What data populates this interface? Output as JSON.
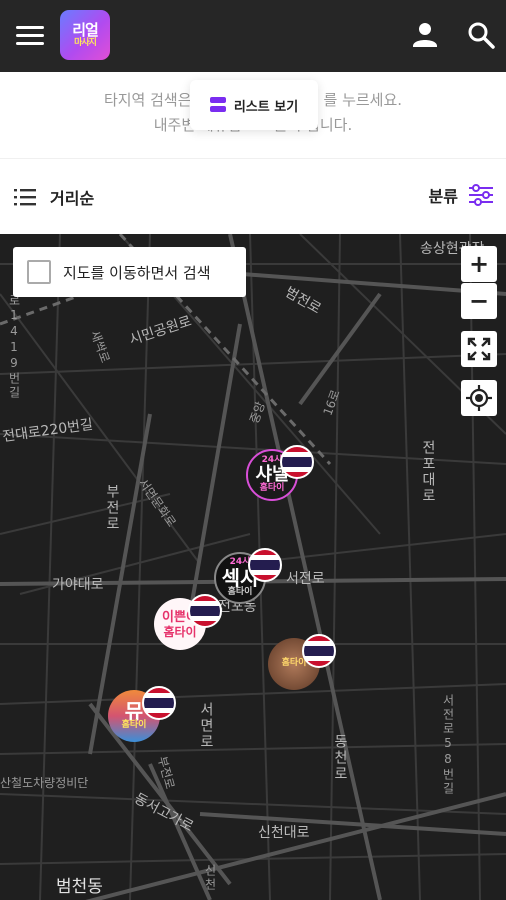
{
  "header": {
    "logo_line1": "리얼",
    "logo_line2": "마사지"
  },
  "notice": {
    "line1_start": "타지역 검색은",
    "line1_end": "를 누르세요.",
    "line2": "내주변 제휴업소 노출이 됩니다.",
    "list_view_label": "리스트 보기"
  },
  "sortbar": {
    "sort_label": "거리순",
    "filter_label": "분류"
  },
  "map": {
    "search_on_move_label": "지도를 이동하면서 검색",
    "zoom_in": "+",
    "zoom_out": "−",
    "labels": {
      "songsang": "송상현광장",
      "beomjeon": "범전로",
      "siminpark": "시민공원로",
      "road220": "전대로220번길",
      "road119": "로1419번길",
      "saeam": "새싹로",
      "gaya": "가야대로",
      "seojeon_a": "서전로",
      "seojeon_b": "서전로",
      "jeonpo": "전포대로",
      "bujeon": "부전로",
      "seomyeon_munhwa": "서면문화로",
      "seomyeon": "서면로",
      "bujeonro2": "부전로",
      "dongcheon": "동천로",
      "dongseo": "동서고가로",
      "sincheon": "신천대로",
      "beomcheon": "범천동",
      "jeonpo_area": "전포동",
      "sinam": "신천",
      "railway": "산철도차량정비단",
      "seojeon58": "서전로58번길",
      "gaya2": "가야",
      "n16": "16로",
      "jungang": "중앙"
    },
    "markers": [
      {
        "line1": "샤넬",
        "line2": "홈타이",
        "badge": "24시"
      },
      {
        "line1": "섹시",
        "line2": "홈타이",
        "badge": "24시"
      },
      {
        "line1": "이쁜이",
        "line2": "홈타이",
        "badge": ""
      },
      {
        "line1": "",
        "line2": "홈타이",
        "badge": ""
      },
      {
        "line1": "뮤",
        "line2": "홈타이",
        "badge": ""
      }
    ]
  },
  "colors": {
    "header_bg": "#262626",
    "accent": "#7a2df0",
    "map_bg": "#1f1f1f",
    "flag_red": "#c8102e",
    "flag_blue": "#241d4f"
  }
}
